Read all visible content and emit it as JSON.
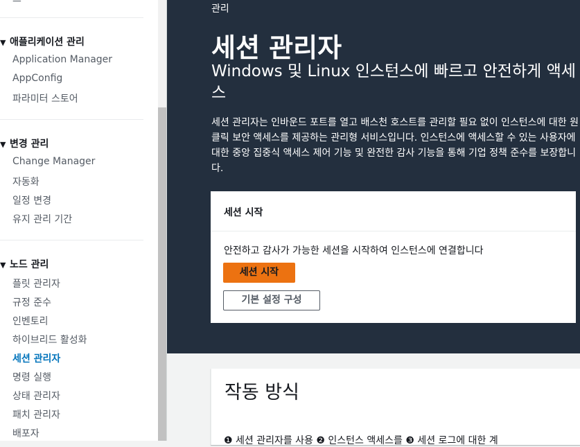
{
  "sidebar": {
    "top_partial": "그",
    "sections": [
      {
        "title": "애플리케이션 관리",
        "items": [
          "Application Manager",
          "AppConfig",
          "파라미터 스토어"
        ]
      },
      {
        "title": "변경 관리",
        "items": [
          "Change Manager",
          "자동화",
          "일정 변경",
          "유지 관리 기간"
        ]
      },
      {
        "title": "노드 관리",
        "items": [
          "플릿 관리자",
          "규정 준수",
          "인벤토리",
          "하이브리드 활성화",
          "세션 관리자",
          "명령 실행",
          "상태 관리자",
          "패치 관리자",
          "배포자"
        ]
      }
    ],
    "active_item": "세션 관리자"
  },
  "hero": {
    "breadcrumb": "관리",
    "title": "세션 관리자",
    "subtitle": "Windows 및 Linux 인스턴스에 빠르고 안전하게 액세스",
    "description": "세션 관리자는 인바운드 포트를 열고 배스천 호스트를 관리할 필요 없이 인스턴스에 대한 원클릭 보안 액세스를 제공하는 관리형 서비스입니다. 인스턴스에 액세스할 수 있는 사용자에 대한 중앙 집중식 액세스 제어 기능 및 완전한 감사 기능을 통해 기업 정책 준수를 보장합니다."
  },
  "start_card": {
    "title": "세션 시작",
    "text": "안전하고 감사가 가능한 세션을 시작하여 인스턴스에 연결합니다",
    "primary_button": "세션 시작",
    "secondary_button": "기본 설정 구성"
  },
  "how_it_works": {
    "title": "작동 방식",
    "steps_partial": "❶ 세션 관리자를 사용    ❷ 인스턴스 액세스를    ❸ 세션 로그에 대한 계"
  },
  "colors": {
    "hero_bg": "#232f3e",
    "accent_orange": "#ec7211",
    "link_blue": "#0073bb"
  }
}
